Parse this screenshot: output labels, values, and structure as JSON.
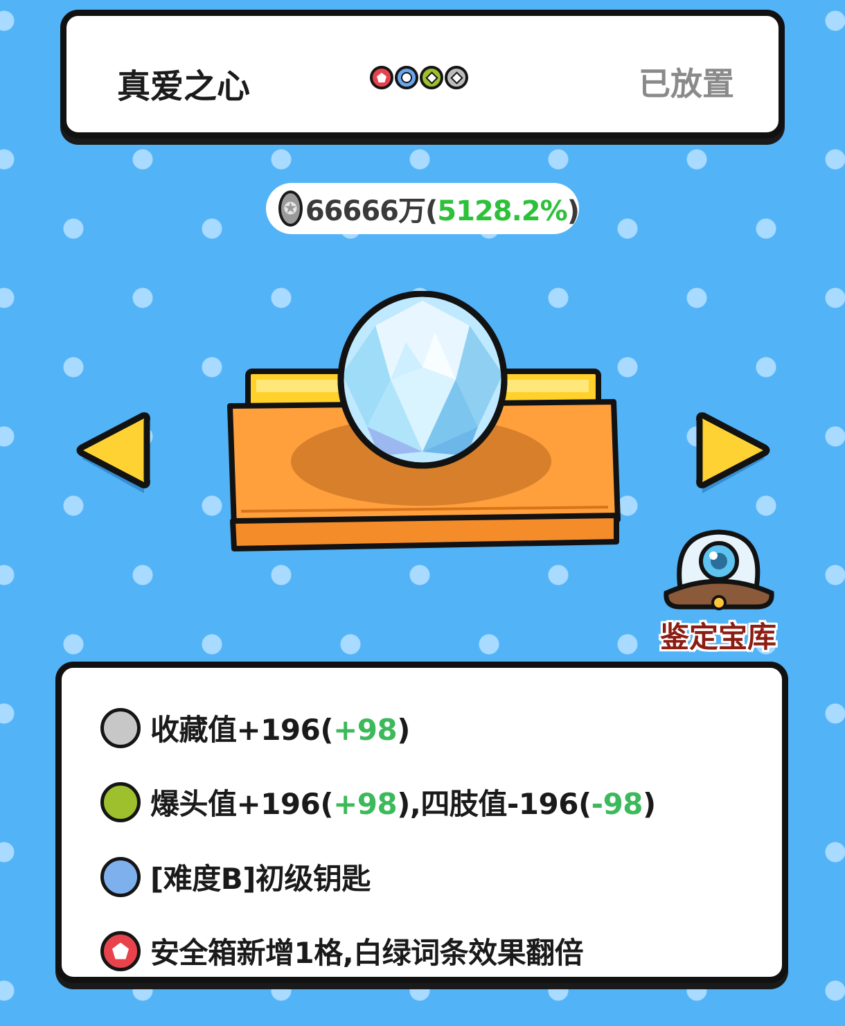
{
  "header": {
    "item_name": "真爱之心",
    "status": "已放置",
    "affix_dots": [
      {
        "icon": "pentagon-icon",
        "color": "#e8434c"
      },
      {
        "icon": "circle-icon",
        "color": "#6aa7f0"
      },
      {
        "icon": "diamond-icon",
        "color": "#9dc02c"
      },
      {
        "icon": "diamond-icon",
        "color": "#bdbdbd"
      }
    ]
  },
  "price": {
    "value": "66666万",
    "open": "(",
    "percent": "5128.2%",
    "close": ")",
    "icon": "coin-icon"
  },
  "item_image": "crystal-gem-on-orange-pedestal",
  "vault": {
    "label": "鉴定宝库",
    "icon": "vault-dome-icon"
  },
  "effects": [
    {
      "icon": "diamond-icon",
      "color": "#c7c7c7",
      "text": "收藏值+196(",
      "bonus": "+98",
      "tail": ")",
      "bonus2": "",
      "tail2": ""
    },
    {
      "icon": "diamond-icon",
      "color": "#9dc02c",
      "text": "爆头值+196(",
      "bonus": "+98",
      "tail": "),四肢值-196(",
      "bonus2": "-98",
      "tail2": ")"
    },
    {
      "icon": "circle-icon",
      "color": "#7fb0ee",
      "text": "[难度B]初级钥匙",
      "bonus": "",
      "tail": "",
      "bonus2": "",
      "tail2": ""
    },
    {
      "icon": "pentagon-icon",
      "color": "#e8434c",
      "text": "安全箱新增1格,白绿词条效果翻倍",
      "bonus": "",
      "tail": "",
      "bonus2": "",
      "tail2": ""
    }
  ]
}
